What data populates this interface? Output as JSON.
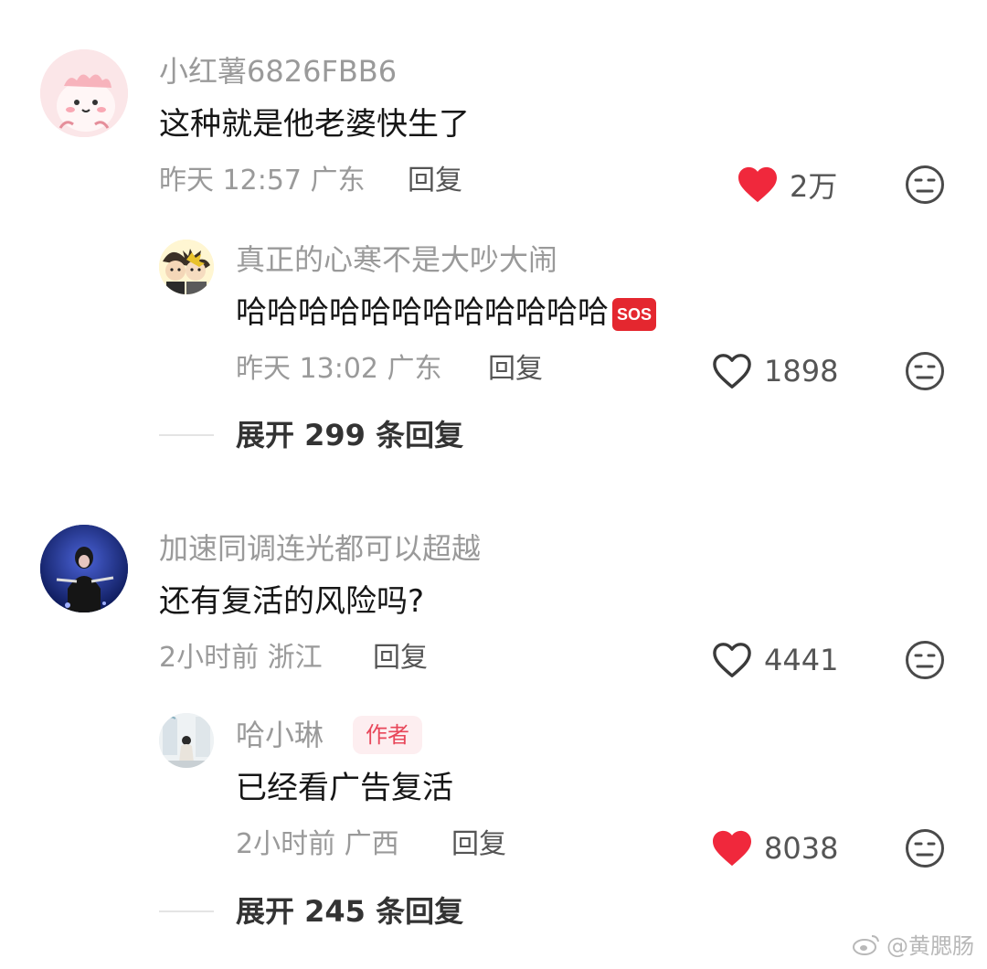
{
  "comments": [
    {
      "username": "小红薯6826FBB6",
      "text": "这种就是他老婆快生了",
      "meta": "昨天 12:57 广东",
      "reply_label": "回复",
      "likes": "2万",
      "liked": true,
      "replies": [
        {
          "username": "真正的心寒不是大吵大闹",
          "text": "哈哈哈哈哈哈哈哈哈哈哈哈",
          "emoji": "SOS",
          "meta": "昨天 13:02 广东",
          "reply_label": "回复",
          "likes": "1898",
          "liked": false
        }
      ],
      "expand_label": "展开 299 条回复"
    },
    {
      "username": "加速同调连光都可以超越",
      "text": "还有复活的风险吗?",
      "meta": "2小时前 浙江",
      "reply_label": "回复",
      "likes": "4441",
      "liked": false,
      "replies": [
        {
          "username": "哈小琳",
          "badge": "作者",
          "text": "已经看广告复活",
          "meta": "2小时前 广西",
          "reply_label": "回复",
          "likes": "8038",
          "liked": true
        }
      ],
      "expand_label": "展开 245 条回复"
    }
  ],
  "watermark": "@黄腮肠",
  "colors": {
    "like_active": "#f0283c",
    "meta_gray": "#9a9a9a",
    "badge_bg": "#fdeef0",
    "badge_text": "#e8475a"
  },
  "icons": {
    "liked": "heart-filled-icon",
    "unliked": "heart-outline-icon",
    "dislike": "meh-face-icon",
    "watermark": "weibo-logo-icon"
  }
}
